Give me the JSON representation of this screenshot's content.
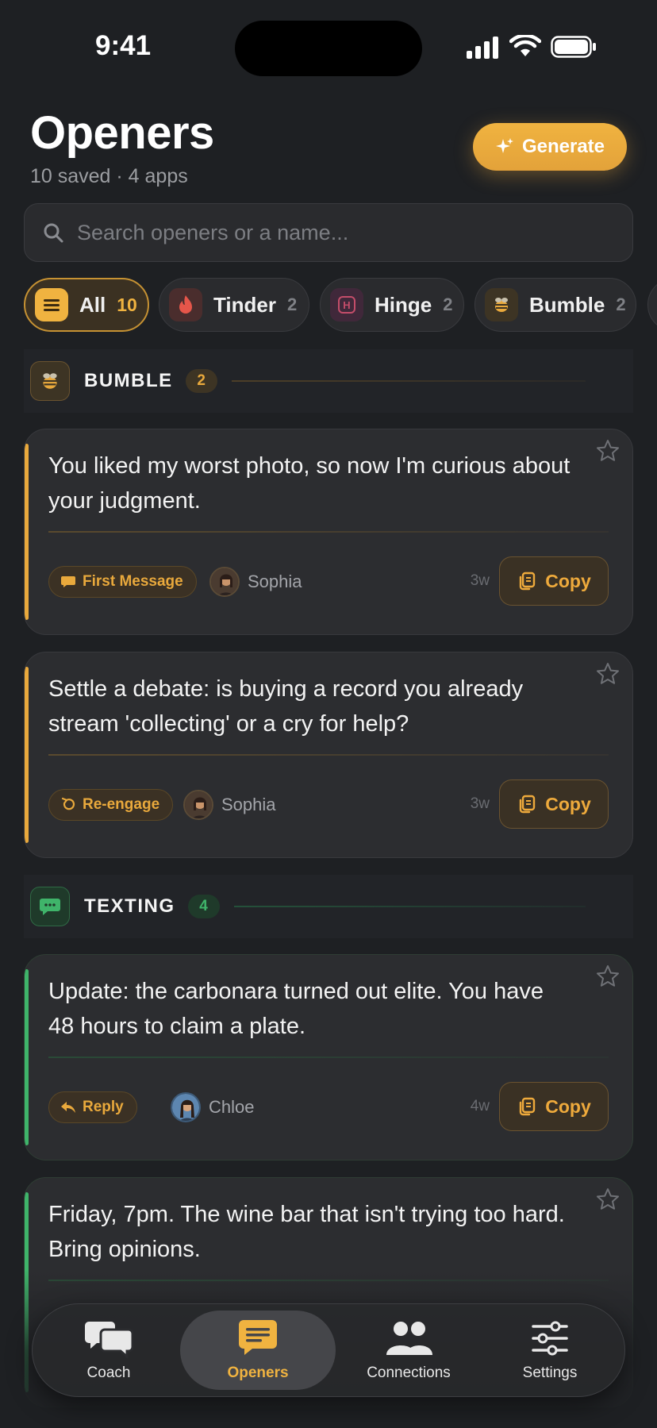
{
  "status": {
    "time": "9:41"
  },
  "header": {
    "title": "Openers",
    "subtitle": "10 saved · 4 apps",
    "generate_label": "Generate"
  },
  "search": {
    "placeholder": "Search openers or a name..."
  },
  "filters": [
    {
      "label": "All",
      "count": "10",
      "active": true
    },
    {
      "label": "Tinder",
      "count": "2"
    },
    {
      "label": "Hinge",
      "count": "2"
    },
    {
      "label": "Bumble",
      "count": "2"
    }
  ],
  "sections": [
    {
      "title": "BUMBLE",
      "count": "2",
      "color": "#e9a93c",
      "cards": [
        {
          "text": "You liked my worst photo, so now I'm curious about your judgment.",
          "tag": "First Message",
          "person": "Sophia",
          "age": "3w",
          "copy": "Copy"
        },
        {
          "text": "Settle a debate: is buying a record you already stream 'collecting' or a cry for help?",
          "tag": "Re-engage",
          "person": "Sophia",
          "age": "3w",
          "copy": "Copy"
        }
      ]
    },
    {
      "title": "TEXTING",
      "count": "4",
      "color": "#3fb46a",
      "cards": [
        {
          "text": "Update: the carbonara turned out elite. You have 48 hours to claim a plate.",
          "tag": "Reply",
          "person": "Chloe",
          "age": "4w",
          "copy": "Copy"
        },
        {
          "text": "Friday, 7pm. The wine bar that isn't trying too hard. Bring opinions."
        }
      ]
    }
  ],
  "nav": [
    {
      "label": "Coach",
      "icon": "chat-bubbles-icon"
    },
    {
      "label": "Openers",
      "icon": "message-icon",
      "active": true
    },
    {
      "label": "Connections",
      "icon": "people-icon"
    },
    {
      "label": "Settings",
      "icon": "sliders-icon"
    }
  ],
  "colors": {
    "accent": "#f0b340",
    "background": "#1e2023",
    "texting": "#3fb46a",
    "tinder": "#e5564a",
    "hinge": "#c44d6a"
  }
}
